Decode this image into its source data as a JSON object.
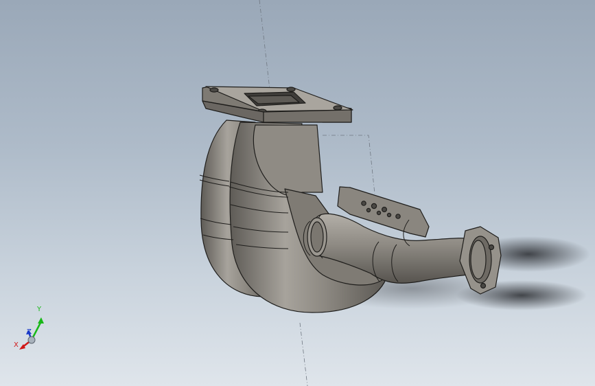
{
  "viewport": {
    "model": "exhaust-manifest-header",
    "background_top": "#9aa8b8",
    "background_bottom": "#dfe5eb",
    "part_color": "#8b8780"
  },
  "triad": {
    "x_label": "X",
    "y_label": "Y",
    "z_label": "Z",
    "x_color": "#d01818",
    "y_color": "#18b818",
    "z_color": "#1838c8"
  }
}
